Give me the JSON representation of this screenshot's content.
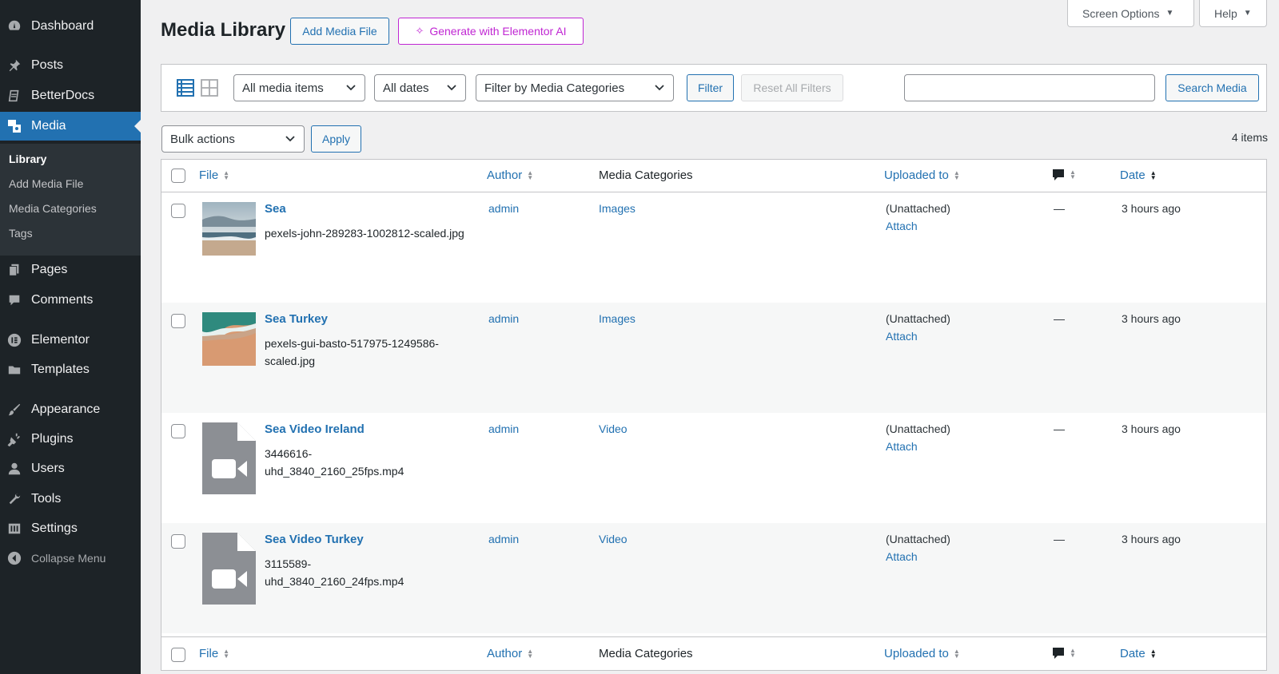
{
  "sidebar": {
    "menu": [
      {
        "label": "Dashboard",
        "icon": "dashboard-icon"
      },
      {
        "label": "Posts",
        "icon": "pushpin-icon"
      },
      {
        "label": "BetterDocs",
        "icon": "docs-icon"
      },
      {
        "label": "Media",
        "icon": "media-icon"
      },
      {
        "label": "Pages",
        "icon": "pages-icon"
      },
      {
        "label": "Comments",
        "icon": "comment-icon"
      },
      {
        "label": "Elementor",
        "icon": "elementor-icon"
      },
      {
        "label": "Templates",
        "icon": "folder-icon"
      },
      {
        "label": "Appearance",
        "icon": "brush-icon"
      },
      {
        "label": "Plugins",
        "icon": "plug-icon"
      },
      {
        "label": "Users",
        "icon": "user-icon"
      },
      {
        "label": "Tools",
        "icon": "wrench-icon"
      },
      {
        "label": "Settings",
        "icon": "settings-icon"
      }
    ],
    "submenu": [
      "Library",
      "Add Media File",
      "Media Categories",
      "Tags"
    ],
    "collapse_label": "Collapse Menu"
  },
  "header": {
    "title": "Media Library",
    "add_button": "Add Media File",
    "ai_button": "Generate with Elementor AI",
    "screen_options": "Screen Options",
    "help": "Help"
  },
  "filters": {
    "media_type": "All media items",
    "dates": "All dates",
    "categories": "Filter by Media Categories",
    "filter_button": "Filter",
    "reset_button": "Reset All Filters",
    "search_placeholder": "",
    "search_button": "Search Media"
  },
  "bulk": {
    "select": "Bulk actions",
    "apply": "Apply",
    "count": "4 items"
  },
  "columns": {
    "file": "File",
    "author": "Author",
    "categories": "Media Categories",
    "uploaded": "Uploaded to",
    "date": "Date"
  },
  "rows": [
    {
      "title": "Sea",
      "file": "pexels-john-289283-1002812-scaled.jpg",
      "author": "admin",
      "category": "Images",
      "uploaded": "(Unattached)",
      "attach": "Attach",
      "comments": "—",
      "date": "3 hours ago"
    },
    {
      "title": "Sea Turkey",
      "file": "pexels-gui-basto-517975-1249586-scaled.jpg",
      "author": "admin",
      "category": "Images",
      "uploaded": "(Unattached)",
      "attach": "Attach",
      "comments": "—",
      "date": "3 hours ago"
    },
    {
      "title": "Sea Video Ireland",
      "file": "3446616-uhd_3840_2160_25fps.mp4",
      "author": "admin",
      "category": "Video",
      "uploaded": "(Unattached)",
      "attach": "Attach",
      "comments": "—",
      "date": "3 hours ago"
    },
    {
      "title": "Sea Video Turkey",
      "file": "3115589-uhd_3840_2160_24fps.mp4",
      "author": "admin",
      "category": "Video",
      "uploaded": "(Unattached)",
      "attach": "Attach",
      "comments": "—",
      "date": "3 hours ago"
    }
  ],
  "colors": {
    "sidebar_bg": "#1d2327",
    "accent": "#2271b1",
    "ai_accent": "#c026d3"
  }
}
